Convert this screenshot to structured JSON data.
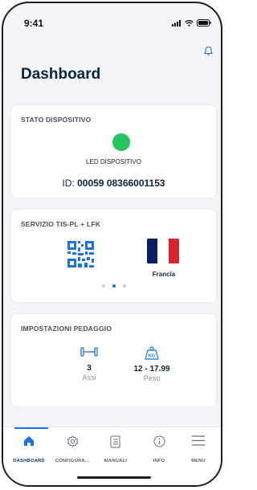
{
  "status_bar": {
    "time": "9:41"
  },
  "header": {
    "title": "Dashboard"
  },
  "device_card": {
    "title": "STATO DISPOSITIVO",
    "led_label": "LED DISPOSITIVO",
    "led_color": "#24c55e",
    "id_prefix": "ID:",
    "id_value": "00059 08366001153"
  },
  "service_card": {
    "title": "SERVIZIO  TIS-PL + LFK",
    "country_label": "Francia",
    "flag_colors": [
      "#0b1d63",
      "#ffffff",
      "#d7262b"
    ],
    "carousel": {
      "pages": 3,
      "active_index": 1
    }
  },
  "toll_card": {
    "title": "IMPOSTAZIONI PEDAGGIO",
    "axles": {
      "value": "3",
      "label": "Assi"
    },
    "weight": {
      "value": "12 - 17.99",
      "label": "Peso",
      "icon_text": "KG"
    }
  },
  "nav": {
    "items": [
      {
        "label": "DASHBOARD",
        "icon": "home-icon"
      },
      {
        "label": "CONFIGURA...",
        "icon": "gear-icon"
      },
      {
        "label": "MANUALI",
        "icon": "book-icon"
      },
      {
        "label": "INFO",
        "icon": "info-icon"
      },
      {
        "label": "MENU",
        "icon": "menu-icon"
      }
    ],
    "active": "DASHBOARD"
  },
  "colors": {
    "accent": "#1a73e8",
    "title": "#0c2340",
    "led": "#24c55e"
  }
}
